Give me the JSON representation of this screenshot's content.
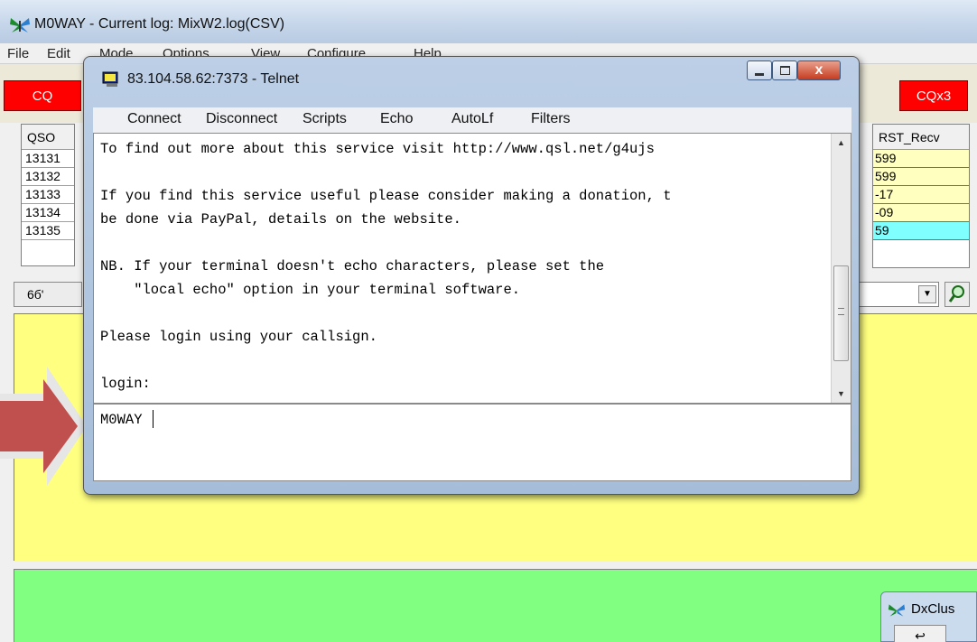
{
  "main": {
    "title": "M0WAY - Current log: MixW2.log(CSV)",
    "menu": [
      "File",
      "Edit",
      "Mode",
      "Options",
      "View",
      "Configure",
      "Help"
    ],
    "cq_left": "CQ",
    "cq_right": "CQx3",
    "qso_header": "QSO",
    "qso_rows": [
      "13131",
      "13132",
      "13133",
      "13134",
      "13135"
    ],
    "rst_header": "RST_Recv",
    "rst_rows": [
      "599",
      "599",
      "-17",
      "-09",
      "59"
    ],
    "rst_highlight_color": "#80ffff",
    "glasses_label": "6б'",
    "yellow_color": "#ffff80",
    "green_color": "#80ff80"
  },
  "dx": {
    "title": "DxClus",
    "button": "↩"
  },
  "telnet": {
    "title": "83.104.58.62:7373 - Telnet",
    "close_label": "x",
    "menu": [
      "Connect",
      "Disconnect",
      "Scripts",
      "Echo",
      "AutoLf",
      "Filters"
    ],
    "lines": [
      "To find out more about this service visit http://www.qsl.net/g4ujs",
      "",
      "If you find this service useful please consider making a donation, t",
      "be done via PayPal, details on the website.",
      "",
      "NB. If your terminal doesn't echo characters, please set the",
      "    \"local echo\" option in your terminal software.",
      "",
      "Please login using your callsign.",
      "",
      "login:"
    ],
    "input_value": "M0WAY",
    "scroll_up": "▲",
    "scroll_down": "▼"
  },
  "arrow_color": "#c0504d"
}
